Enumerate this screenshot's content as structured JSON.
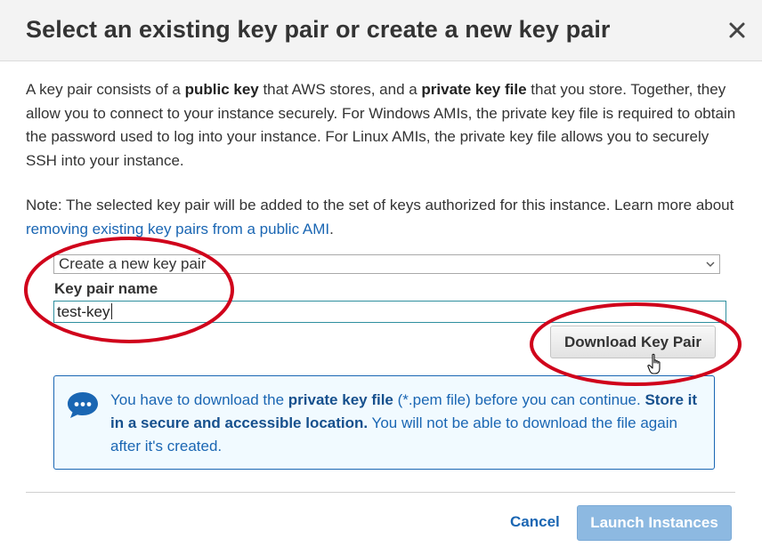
{
  "dialog": {
    "title": "Select an existing key pair or create a new key pair",
    "close_icon": "close-icon"
  },
  "intro": {
    "t1": "A key pair consists of a ",
    "b1": "public key",
    "t2": " that AWS stores, and a ",
    "b2": "private key file",
    "t3": " that you store. Together, they allow you to connect to your instance securely. For Windows AMIs, the private key file is required to obtain the password used to log into your instance. For Linux AMIs, the private key file allows you to securely SSH into your instance."
  },
  "note": {
    "text": "Note: The selected key pair will be added to the set of keys authorized for this instance. Learn more about ",
    "link": "removing existing key pairs from a public AMI",
    "end": "."
  },
  "key_pair_select": {
    "selected": "Create a new key pair",
    "icon": "chevron-down-icon"
  },
  "key_pair_name": {
    "label": "Key pair name",
    "value": "test-key"
  },
  "download_button": {
    "label": "Download Key Pair"
  },
  "info_box": {
    "icon": "speech-bubble-icon",
    "t1": "You have to download the ",
    "b1": "private key file",
    "t2": " (*.pem file) before you can continue. ",
    "b2": "Store it in a secure and accessible location.",
    "t3": " You will not be able to download the file again after it's created."
  },
  "footer": {
    "cancel_label": "Cancel",
    "launch_label": "Launch Instances"
  },
  "colors": {
    "link_blue": "#1a66b3",
    "info_bg": "#f1faff",
    "launch_disabled": "#8db9e1",
    "annotation_red": "#d0021b"
  }
}
